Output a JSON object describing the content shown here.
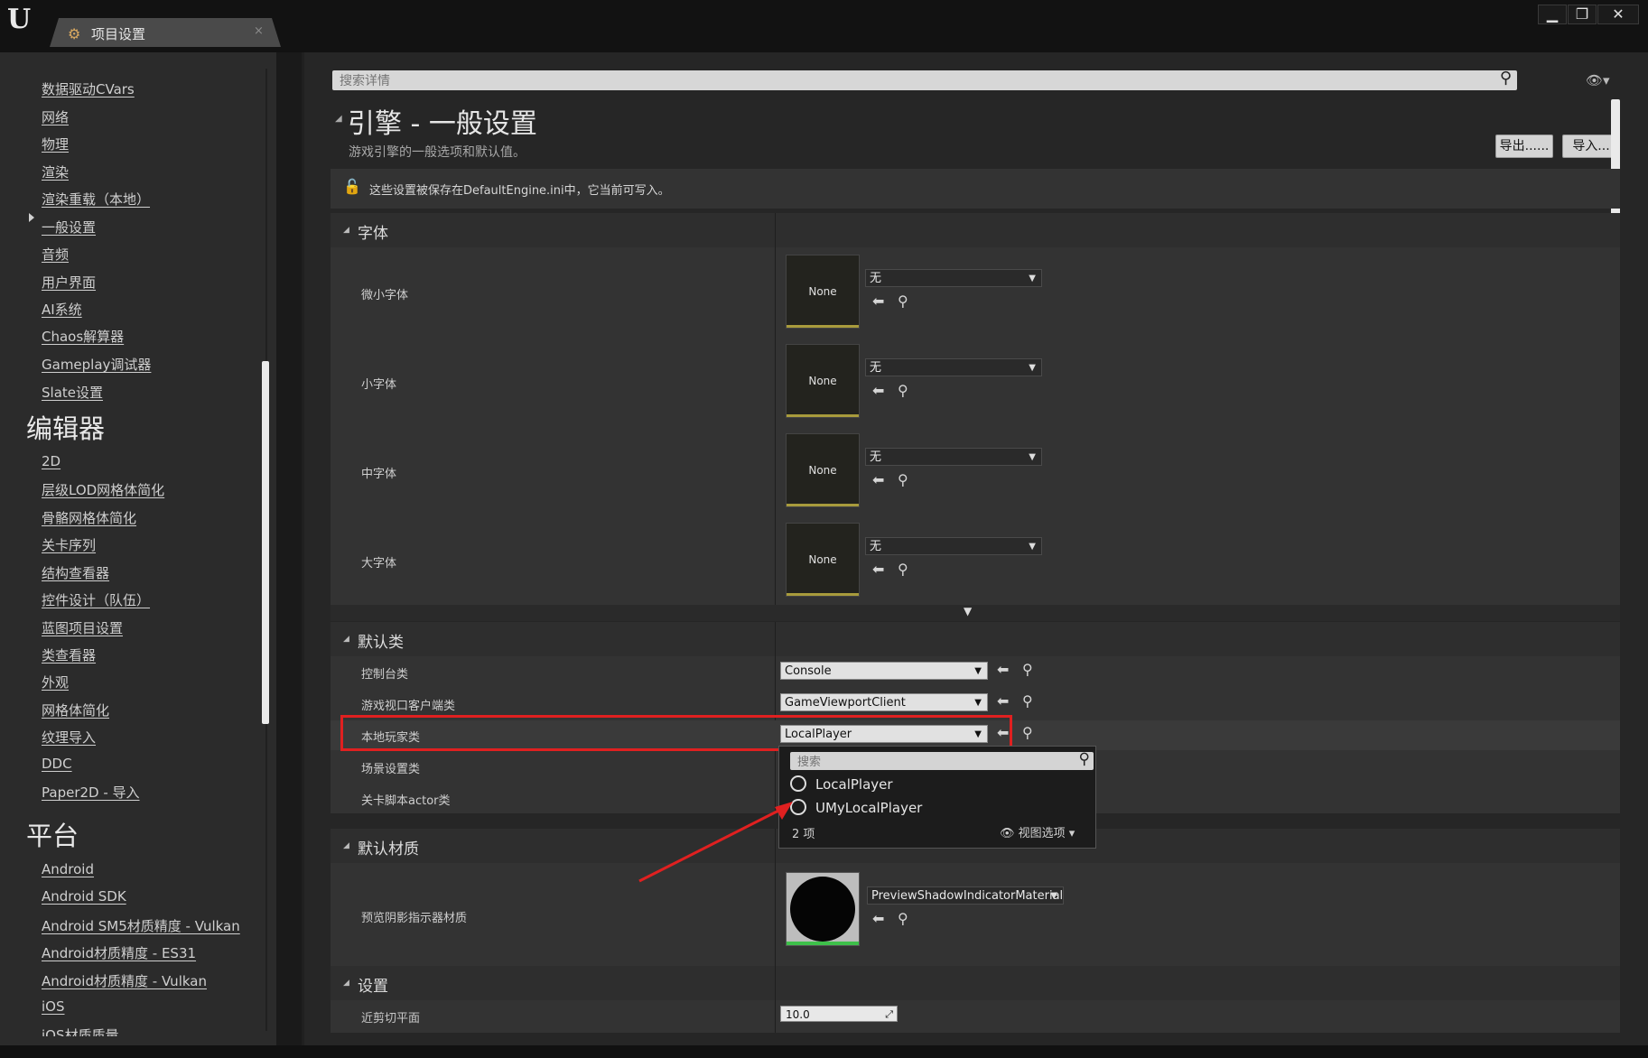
{
  "window": {
    "tab_title": "项目设置",
    "tab_close": "×",
    "logo": "U",
    "controls": {
      "minimize": "▁",
      "maximize": "❐",
      "close": "✕"
    }
  },
  "sidebar": {
    "items_top": [
      "数据驱动CVars",
      "网络",
      "物理",
      "渲染",
      "渲染重载（本地）",
      "一般设置",
      "音频",
      "用户界面",
      "AI系统",
      "Chaos解算器",
      "Gameplay调试器",
      "Slate设置"
    ],
    "editor_header": "编辑器",
    "items_editor": [
      "2D",
      "层级LOD网格体简化",
      "骨骼网格体简化",
      "关卡序列",
      "结构查看器",
      "控件设计（队伍）",
      "蓝图项目设置",
      "类查看器",
      "外观",
      "网格体简化",
      "纹理导入",
      "DDC",
      "Paper2D - 导入"
    ],
    "platform_header": "平台",
    "items_platform": [
      "Android",
      "Android SDK",
      "Android SM5材质精度 - Vulkan",
      "Android材质精度 - ES31",
      "Android材质精度 - Vulkan",
      "iOS",
      "iOS材质质量"
    ],
    "active_item": "一般设置"
  },
  "search": {
    "placeholder": "搜索详情"
  },
  "header": {
    "title": "引擎 - 一般设置",
    "subtitle": "游戏引擎的一般选项和默认值。",
    "export_label": "导出......",
    "import_label": "导入..."
  },
  "info": {
    "text": "这些设置被保存在DefaultEngine.ini中，它当前可写入。"
  },
  "fonts": {
    "section": "字体",
    "rows": [
      {
        "label": "微小字体",
        "thumb": "None",
        "value": "无"
      },
      {
        "label": "小字体",
        "thumb": "None",
        "value": "无"
      },
      {
        "label": "中字体",
        "thumb": "None",
        "value": "无"
      },
      {
        "label": "大字体",
        "thumb": "None",
        "value": "无"
      }
    ]
  },
  "default_classes": {
    "section": "默认类",
    "rows": [
      {
        "label": "控制台类",
        "value": "Console"
      },
      {
        "label": "游戏视口客户端类",
        "value": "GameViewportClient"
      },
      {
        "label": "本地玩家类",
        "value": "LocalPlayer"
      },
      {
        "label": "场景设置类",
        "value": ""
      },
      {
        "label": "关卡脚本actor类",
        "value": ""
      }
    ]
  },
  "popup": {
    "search_placeholder": "搜索",
    "options": [
      "LocalPlayer",
      "UMyLocalPlayer"
    ],
    "count": "2 项",
    "view_options": "视图选项"
  },
  "default_materials": {
    "section": "默认材质",
    "rows": [
      {
        "label": "预览阴影指示器材质",
        "value": "PreviewShadowIndicatorMaterial"
      }
    ]
  },
  "settings": {
    "section": "设置",
    "rows": [
      {
        "label": "近剪切平面",
        "value": "10.0"
      }
    ]
  },
  "colors": {
    "highlight": "#e02020",
    "arrow": "#e02020"
  }
}
